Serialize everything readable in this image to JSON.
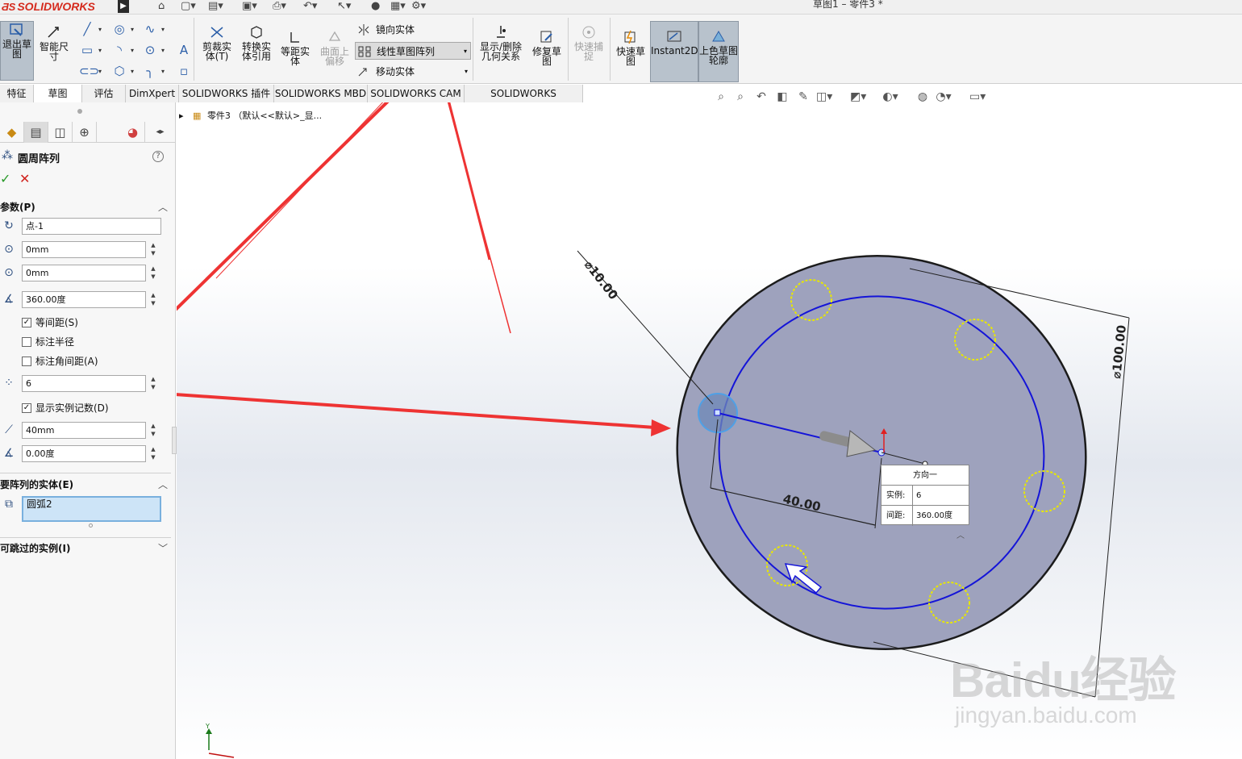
{
  "app": {
    "logo": "SOLIDWORKS",
    "doc_title": "草图1 – 零件3 *"
  },
  "ribbon": {
    "exit_sketch": "退出草图",
    "smart_dim": "智能尺寸",
    "trim": "剪裁实体(T)",
    "convert": "转换实体引用",
    "offset": "等距实体",
    "surface_offset": "曲面上偏移",
    "mirror": "镜向实体",
    "linear_pattern": "线性草图阵列",
    "move": "移动实体",
    "relations": "显示/删除几何关系",
    "repair": "修复草图",
    "snap": "快速捕捉",
    "rapid": "快速草图",
    "instant2d": "Instant2D",
    "shaded": "上色草图轮廓"
  },
  "tabs": [
    "特征",
    "草图",
    "评估",
    "DimXpert",
    "SOLIDWORKS 插件",
    "SOLIDWORKS MBD",
    "SOLIDWORKS CAM",
    "SOLIDWORKS Inspection"
  ],
  "panel": {
    "title": "圆周阵列",
    "params_head": "参数(P)",
    "center": "点-1",
    "x": "0mm",
    "y": "0mm",
    "angle": "360.00度",
    "equal_spacing": "等间距(S)",
    "dim_radius": "标注半径",
    "dim_angle": "标注角间距(A)",
    "count": "6",
    "show_count": "显示实例记数(D)",
    "radius": "40mm",
    "arc_angle": "0.00度",
    "entities_head": "要阵列的实体(E)",
    "entity": "圆弧2",
    "skip_head": "可跳过的实例(I)"
  },
  "tree": {
    "label": "零件3 （默认<<默认>_显..."
  },
  "drawing": {
    "dim_small": "⌀10.00",
    "dim_large": "⌀100.00",
    "dim_radius": "40.00",
    "popup_title": "方向一",
    "popup_inst_label": "实例:",
    "popup_inst_value": "6",
    "popup_space_label": "间距:",
    "popup_space_value": "360.00度"
  },
  "watermark": {
    "brand": "Baidu经验",
    "url": "jingyan.baidu.com"
  },
  "colors": {
    "sketch_blue": "#1414d8",
    "pattern_yellow": "#e8e800",
    "face": "#9ea2bd",
    "arrow_red": "#ee3333"
  }
}
